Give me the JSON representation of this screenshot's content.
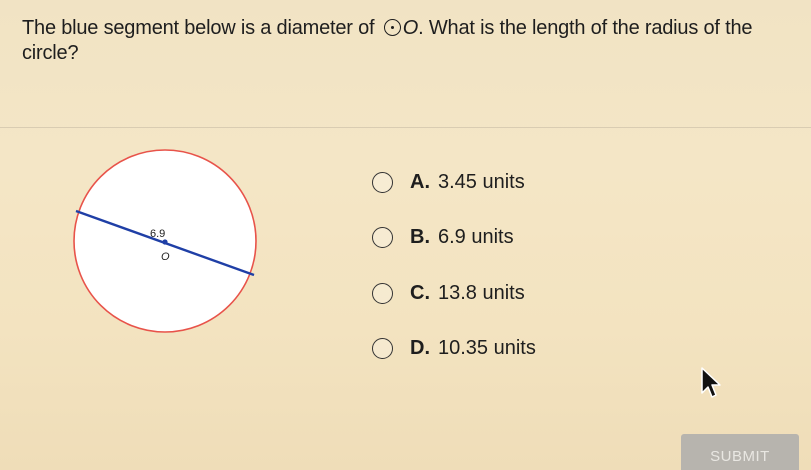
{
  "question": {
    "text_before_symbol": "The blue segment below is a diameter of ",
    "symbol_letter": "O",
    "text_after_symbol": ". What is the length of the radius of the circle?"
  },
  "figure": {
    "diameter_label": "6.9",
    "center_label": "O",
    "colors": {
      "circle": "#e8534a",
      "diameter": "#1f3fa6"
    }
  },
  "options": [
    {
      "letter": "A.",
      "text": "3.45 units"
    },
    {
      "letter": "B.",
      "text": "6.9 units"
    },
    {
      "letter": "C.",
      "text": "13.8 units"
    },
    {
      "letter": "D.",
      "text": "10.35 units"
    }
  ],
  "submit_label": "SUBMIT"
}
